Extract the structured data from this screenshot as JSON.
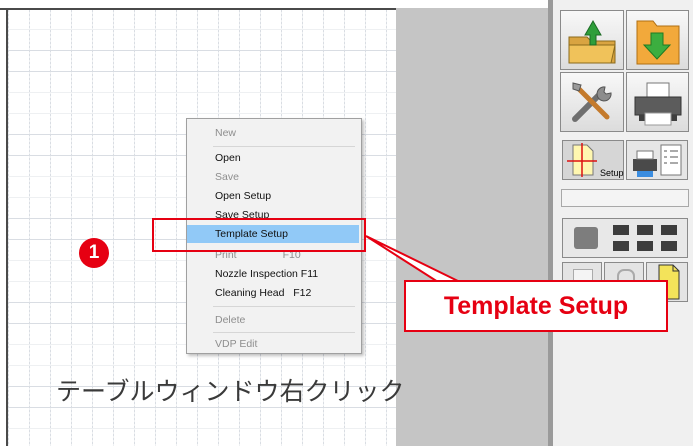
{
  "context_menu": {
    "items": [
      {
        "label": "New",
        "enabled": false
      },
      {
        "label": "Open",
        "enabled": true
      },
      {
        "label": "Save",
        "enabled": false
      },
      {
        "label": "Open Setup",
        "enabled": true
      },
      {
        "label": "Save Setup",
        "enabled": true
      },
      {
        "label": "Template Setup",
        "enabled": true,
        "highlighted": true
      },
      {
        "label": "Print",
        "shortcut": "F10",
        "enabled": false
      },
      {
        "label": "Nozzle Inspection F11",
        "enabled": true
      },
      {
        "label": "Cleaning Head   F12",
        "enabled": true
      },
      {
        "label": "Delete",
        "enabled": false
      },
      {
        "label": "VDP Edit",
        "enabled": false
      }
    ]
  },
  "annotation": {
    "step_number": "❶",
    "callout": "Template Setup",
    "caption": "テーブルウィンドウ右クリック",
    "accent_color": "#e60012"
  },
  "toolbar": {
    "setup_label": "Setup",
    "icons": [
      "open-folder-icon",
      "download-folder-icon",
      "tools-icon",
      "printer-icon",
      "template-setup-icon",
      "print-list-icon",
      "print-mode-icon",
      "multi-print-icon",
      "file-icon",
      "clip-icon",
      "note-icon"
    ]
  }
}
